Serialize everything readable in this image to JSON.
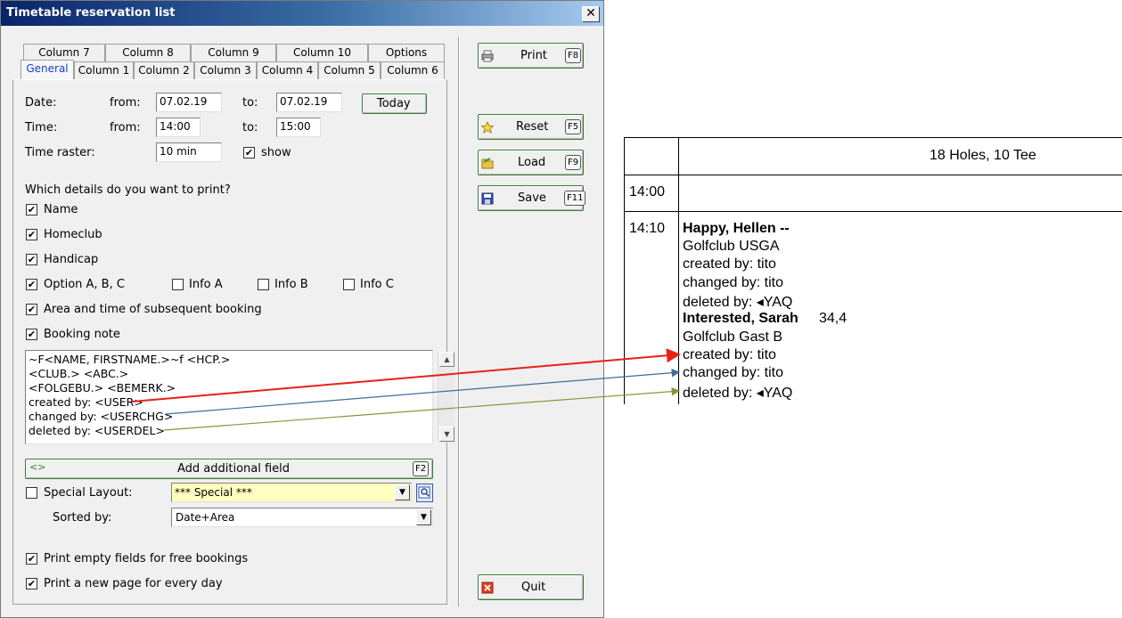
{
  "window": {
    "title": "Timetable reservation list",
    "close_label": "✕"
  },
  "tabs": {
    "row1": [
      "Column 7",
      "Column 8",
      "Column 9",
      "Column 10",
      "Options"
    ],
    "row2": [
      "General",
      "Column 1",
      "Column 2",
      "Column 3",
      "Column 4",
      "Column 5",
      "Column 6"
    ]
  },
  "general": {
    "date_label": "Date:",
    "from_label": "from:",
    "to_label": "to:",
    "date_from": "07.02.19",
    "date_to": "07.02.19",
    "today_button": "Today",
    "time_label": "Time:",
    "time_from": "14:00",
    "time_to": "15:00",
    "raster_label": "Time raster:",
    "raster_value": "10 min",
    "show_label": "show",
    "details_question": "Which details do you want to print?",
    "name_label": "Name",
    "homeclub_label": "Homeclub",
    "handicap_label": "Handicap",
    "option_label": "Option A, B, C",
    "info_a_label": "Info A",
    "info_b_label": "Info B",
    "info_c_label": "Info C",
    "area_label": "Area and time of subsequent booking",
    "note_label": "Booking note",
    "note_lines": [
      "~F<NAME, FIRSTNAME.>~f <HCP.>",
      "<CLUB.> <ABC.>",
      "<FOLGEBU.> <BEMERK.>",
      "created by: <USER>",
      "changed by: <USERCHG>",
      "deleted by: <USERDEL>"
    ],
    "add_field_label": "Add additional field",
    "add_field_key": "F2",
    "special_layout_label": "Special Layout:",
    "special_layout_value": "*** Special ***",
    "sorted_label": "Sorted by:",
    "sorted_value": "Date+Area",
    "empty_fields_label": "Print empty fields for free bookings",
    "new_page_label": "Print a new page for every day",
    "check_mark": "✔"
  },
  "side_buttons": {
    "print": {
      "label": "Print",
      "key": "F8"
    },
    "reset": {
      "label": "Reset",
      "key": "F5"
    },
    "load": {
      "label": "Load",
      "key": "F9"
    },
    "save": {
      "label": "Save",
      "key": "F11"
    },
    "quit": {
      "label": "Quit"
    }
  },
  "preview": {
    "header": "18 Holes, 10 Tee",
    "time1": "14:00",
    "time2": "14:10",
    "booking1_name": "Happy, Hellen --",
    "booking1_club": "Golfclub USGA",
    "booking1_created": "created by: tito",
    "booking1_changed": "changed by: tito",
    "booking1_deleted": "deleted by: ◂YAQ",
    "booking2_name": "Interested, Sarah",
    "booking2_hcp": "34,4",
    "booking2_club": "Golfclub Gast B",
    "booking2_created": "created by: tito",
    "booking2_changed": "changed by: tito",
    "booking2_deleted": "deleted by: ◂YAQ"
  },
  "colors": {
    "arrow_created": "#e8201a",
    "arrow_changed": "#3f6e9a",
    "arrow_deleted": "#7c9a3c",
    "special_layout_bg": "#ffffc0"
  }
}
